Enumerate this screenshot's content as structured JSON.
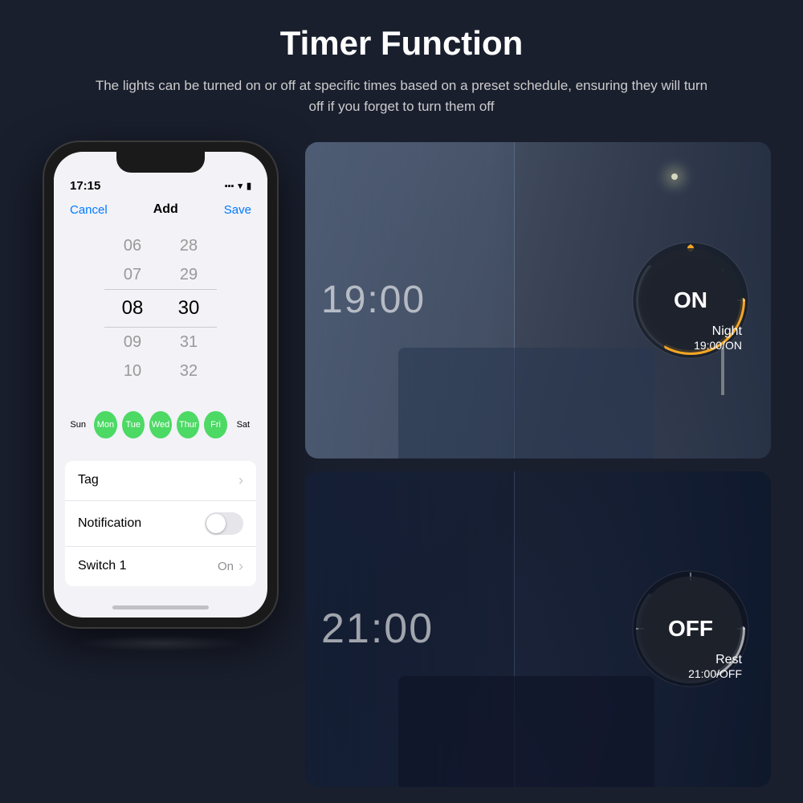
{
  "page": {
    "background_color": "#1a1f2e",
    "title": "Timer Function",
    "subtitle": "The lights can be turned on or off at specific times based on a preset schedule, ensuring they will turn off if you forget to turn them off"
  },
  "phone": {
    "status_bar": {
      "time": "17:15",
      "icons": "▪▪ ▾ ▮"
    },
    "toolbar": {
      "cancel": "Cancel",
      "add": "Add",
      "save": "Save"
    },
    "time_picker": {
      "hours": [
        "06",
        "07",
        "08",
        "09",
        "10"
      ],
      "minutes": [
        "28",
        "29",
        "30",
        "31",
        "32"
      ],
      "selected_hour": "08",
      "selected_minute": "30"
    },
    "days": [
      {
        "label": "Sun",
        "active": false
      },
      {
        "label": "Mon",
        "active": true
      },
      {
        "label": "Tue",
        "active": true
      },
      {
        "label": "Wed",
        "active": true
      },
      {
        "label": "Thur",
        "active": true
      },
      {
        "label": "Fri",
        "active": true
      },
      {
        "label": "Sat",
        "active": false
      }
    ],
    "settings": [
      {
        "label": "Tag",
        "value": "",
        "type": "chevron"
      },
      {
        "label": "Notification",
        "value": "",
        "type": "toggle",
        "toggle_on": false
      },
      {
        "label": "Switch 1",
        "value": "On",
        "type": "chevron"
      }
    ]
  },
  "panels": [
    {
      "id": "on-panel",
      "time": "19:00",
      "state": "ON",
      "label": "Night",
      "schedule": "19:00/ON",
      "dial_color": "#f5a623",
      "arc_progress": 0.65
    },
    {
      "id": "off-panel",
      "time": "21:00",
      "state": "OFF",
      "label": "Rest",
      "schedule": "21:00/OFF",
      "dial_color": "#ffffff",
      "arc_progress": 0.45
    }
  ]
}
